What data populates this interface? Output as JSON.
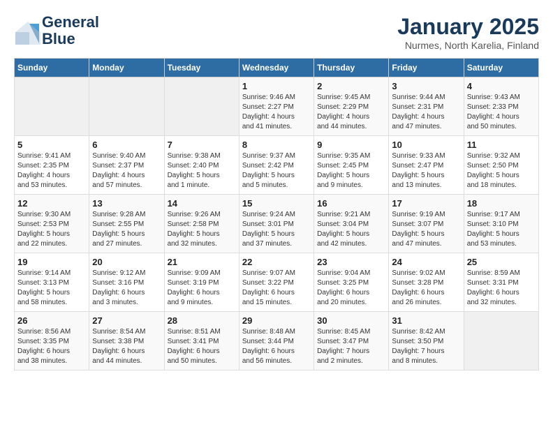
{
  "header": {
    "logo_line1": "General",
    "logo_line2": "Blue",
    "title": "January 2025",
    "subtitle": "Nurmes, North Karelia, Finland"
  },
  "weekdays": [
    "Sunday",
    "Monday",
    "Tuesday",
    "Wednesday",
    "Thursday",
    "Friday",
    "Saturday"
  ],
  "weeks": [
    [
      {
        "day": "",
        "text": ""
      },
      {
        "day": "",
        "text": ""
      },
      {
        "day": "",
        "text": ""
      },
      {
        "day": "1",
        "text": "Sunrise: 9:46 AM\nSunset: 2:27 PM\nDaylight: 4 hours\nand 41 minutes."
      },
      {
        "day": "2",
        "text": "Sunrise: 9:45 AM\nSunset: 2:29 PM\nDaylight: 4 hours\nand 44 minutes."
      },
      {
        "day": "3",
        "text": "Sunrise: 9:44 AM\nSunset: 2:31 PM\nDaylight: 4 hours\nand 47 minutes."
      },
      {
        "day": "4",
        "text": "Sunrise: 9:43 AM\nSunset: 2:33 PM\nDaylight: 4 hours\nand 50 minutes."
      }
    ],
    [
      {
        "day": "5",
        "text": "Sunrise: 9:41 AM\nSunset: 2:35 PM\nDaylight: 4 hours\nand 53 minutes."
      },
      {
        "day": "6",
        "text": "Sunrise: 9:40 AM\nSunset: 2:37 PM\nDaylight: 4 hours\nand 57 minutes."
      },
      {
        "day": "7",
        "text": "Sunrise: 9:38 AM\nSunset: 2:40 PM\nDaylight: 5 hours\nand 1 minute."
      },
      {
        "day": "8",
        "text": "Sunrise: 9:37 AM\nSunset: 2:42 PM\nDaylight: 5 hours\nand 5 minutes."
      },
      {
        "day": "9",
        "text": "Sunrise: 9:35 AM\nSunset: 2:45 PM\nDaylight: 5 hours\nand 9 minutes."
      },
      {
        "day": "10",
        "text": "Sunrise: 9:33 AM\nSunset: 2:47 PM\nDaylight: 5 hours\nand 13 minutes."
      },
      {
        "day": "11",
        "text": "Sunrise: 9:32 AM\nSunset: 2:50 PM\nDaylight: 5 hours\nand 18 minutes."
      }
    ],
    [
      {
        "day": "12",
        "text": "Sunrise: 9:30 AM\nSunset: 2:53 PM\nDaylight: 5 hours\nand 22 minutes."
      },
      {
        "day": "13",
        "text": "Sunrise: 9:28 AM\nSunset: 2:55 PM\nDaylight: 5 hours\nand 27 minutes."
      },
      {
        "day": "14",
        "text": "Sunrise: 9:26 AM\nSunset: 2:58 PM\nDaylight: 5 hours\nand 32 minutes."
      },
      {
        "day": "15",
        "text": "Sunrise: 9:24 AM\nSunset: 3:01 PM\nDaylight: 5 hours\nand 37 minutes."
      },
      {
        "day": "16",
        "text": "Sunrise: 9:21 AM\nSunset: 3:04 PM\nDaylight: 5 hours\nand 42 minutes."
      },
      {
        "day": "17",
        "text": "Sunrise: 9:19 AM\nSunset: 3:07 PM\nDaylight: 5 hours\nand 47 minutes."
      },
      {
        "day": "18",
        "text": "Sunrise: 9:17 AM\nSunset: 3:10 PM\nDaylight: 5 hours\nand 53 minutes."
      }
    ],
    [
      {
        "day": "19",
        "text": "Sunrise: 9:14 AM\nSunset: 3:13 PM\nDaylight: 5 hours\nand 58 minutes."
      },
      {
        "day": "20",
        "text": "Sunrise: 9:12 AM\nSunset: 3:16 PM\nDaylight: 6 hours\nand 3 minutes."
      },
      {
        "day": "21",
        "text": "Sunrise: 9:09 AM\nSunset: 3:19 PM\nDaylight: 6 hours\nand 9 minutes."
      },
      {
        "day": "22",
        "text": "Sunrise: 9:07 AM\nSunset: 3:22 PM\nDaylight: 6 hours\nand 15 minutes."
      },
      {
        "day": "23",
        "text": "Sunrise: 9:04 AM\nSunset: 3:25 PM\nDaylight: 6 hours\nand 20 minutes."
      },
      {
        "day": "24",
        "text": "Sunrise: 9:02 AM\nSunset: 3:28 PM\nDaylight: 6 hours\nand 26 minutes."
      },
      {
        "day": "25",
        "text": "Sunrise: 8:59 AM\nSunset: 3:31 PM\nDaylight: 6 hours\nand 32 minutes."
      }
    ],
    [
      {
        "day": "26",
        "text": "Sunrise: 8:56 AM\nSunset: 3:35 PM\nDaylight: 6 hours\nand 38 minutes."
      },
      {
        "day": "27",
        "text": "Sunrise: 8:54 AM\nSunset: 3:38 PM\nDaylight: 6 hours\nand 44 minutes."
      },
      {
        "day": "28",
        "text": "Sunrise: 8:51 AM\nSunset: 3:41 PM\nDaylight: 6 hours\nand 50 minutes."
      },
      {
        "day": "29",
        "text": "Sunrise: 8:48 AM\nSunset: 3:44 PM\nDaylight: 6 hours\nand 56 minutes."
      },
      {
        "day": "30",
        "text": "Sunrise: 8:45 AM\nSunset: 3:47 PM\nDaylight: 7 hours\nand 2 minutes."
      },
      {
        "day": "31",
        "text": "Sunrise: 8:42 AM\nSunset: 3:50 PM\nDaylight: 7 hours\nand 8 minutes."
      },
      {
        "day": "",
        "text": ""
      }
    ]
  ]
}
